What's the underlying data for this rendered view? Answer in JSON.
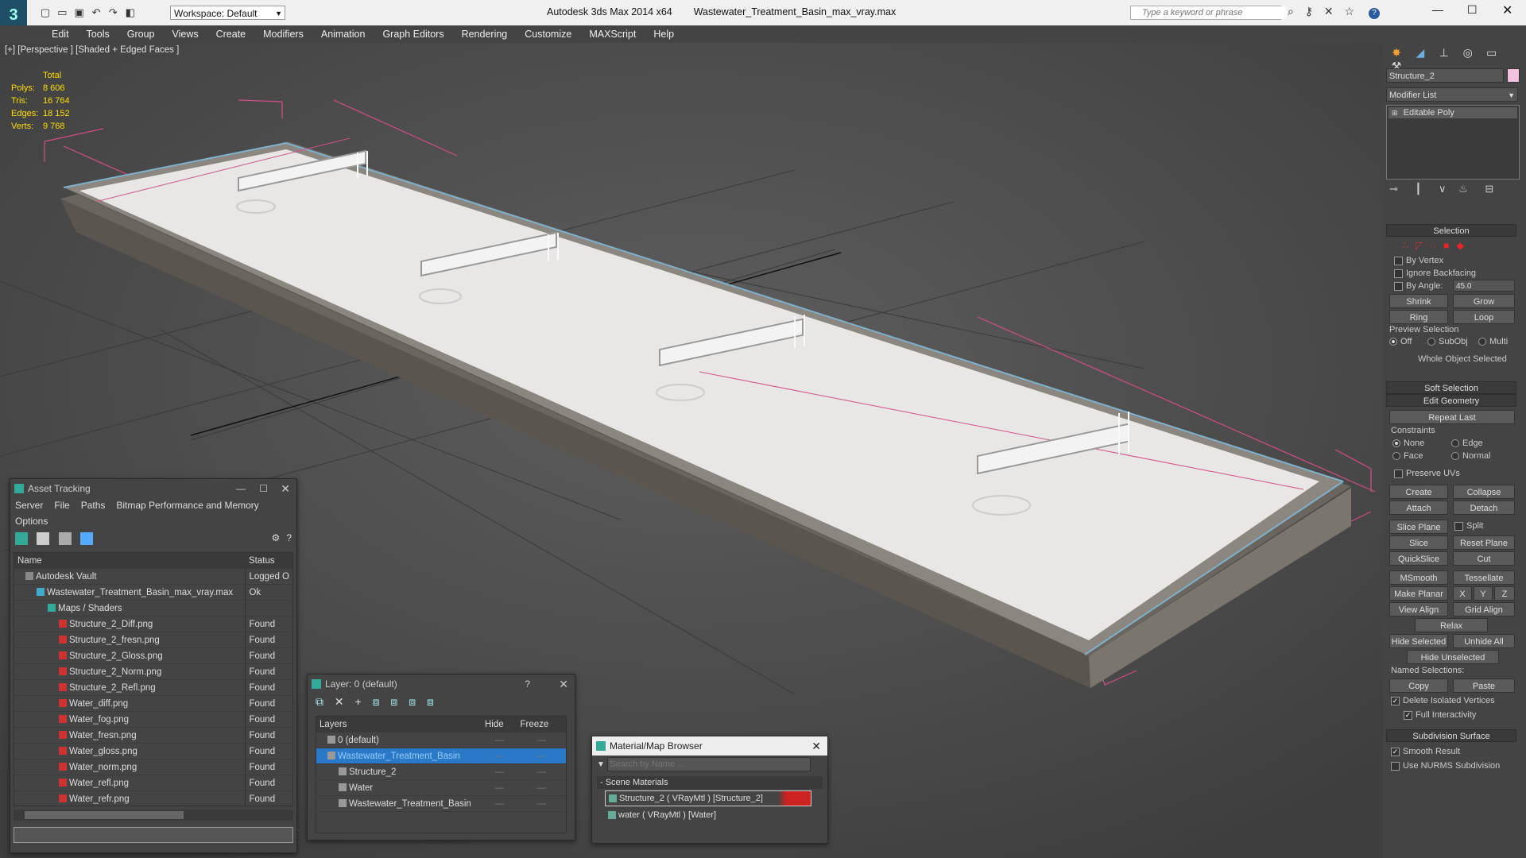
{
  "titlebar": {
    "app_title": "Autodesk 3ds Max  2014 x64",
    "file_title": "Wastewater_Treatment_Basin_max_vray.max",
    "workspace": "Workspace: Default",
    "search_placeholder": "Type a keyword or phrase"
  },
  "menu": [
    "Edit",
    "Tools",
    "Group",
    "Views",
    "Create",
    "Modifiers",
    "Animation",
    "Graph Editors",
    "Rendering",
    "Customize",
    "MAXScript",
    "Help"
  ],
  "viewport": {
    "label": "[+] [Perspective ] [Shaded + Edged Faces ]",
    "stats": {
      "header": "Total",
      "polys_label": "Polys:",
      "polys": "8 606",
      "tris_label": "Tris:",
      "tris": "16 764",
      "edges_label": "Edges:",
      "edges": "18 152",
      "verts_label": "Verts:",
      "verts": "9 768"
    }
  },
  "command_panel": {
    "object_name": "Structure_2",
    "modifier_list": "Modifier List",
    "stack_item": "Editable Poly",
    "selection": {
      "title": "Selection",
      "by_vertex": "By Vertex",
      "ignore_backfacing": "Ignore Backfacing",
      "by_angle": "By Angle:",
      "angle_value": "45.0",
      "shrink": "Shrink",
      "grow": "Grow",
      "ring": "Ring",
      "loop": "Loop",
      "preview_selection": "Preview Selection",
      "off": "Off",
      "subobj": "SubObj",
      "multi": "Multi",
      "status": "Whole Object Selected"
    },
    "soft_selection": "Soft Selection",
    "edit_geometry": {
      "title": "Edit Geometry",
      "repeat_last": "Repeat Last",
      "constraints": "Constraints",
      "none": "None",
      "edge": "Edge",
      "face": "Face",
      "normal": "Normal",
      "preserve_uvs": "Preserve UVs",
      "create": "Create",
      "collapse": "Collapse",
      "attach": "Attach",
      "detach": "Detach",
      "slice_plane": "Slice Plane",
      "split": "Split",
      "slice": "Slice",
      "reset_plane": "Reset Plane",
      "quickslice": "QuickSlice",
      "cut": "Cut",
      "msmooth": "MSmooth",
      "tessellate": "Tessellate",
      "make_planar": "Make Planar",
      "x": "X",
      "y": "Y",
      "z": "Z",
      "view_align": "View Align",
      "grid_align": "Grid Align",
      "relax": "Relax",
      "hide_selected": "Hide Selected",
      "unhide_all": "Unhide All",
      "hide_unselected": "Hide Unselected",
      "named_selections": "Named Selections:",
      "copy": "Copy",
      "paste": "Paste",
      "delete_isolated": "Delete Isolated Vertices",
      "full_interactivity": "Full Interactivity"
    },
    "subdivision_surface": {
      "title": "Subdivision Surface",
      "smooth_result": "Smooth Result",
      "use_nurms": "Use NURMS Subdivision"
    }
  },
  "asset_tracking": {
    "title": "Asset Tracking",
    "menu": [
      "Server",
      "File",
      "Paths",
      "Bitmap Performance and Memory"
    ],
    "menu2": "Options",
    "col_name": "Name",
    "col_status": "Status",
    "rows": [
      {
        "name": "Autodesk Vault",
        "status": "Logged O",
        "indent": 1
      },
      {
        "name": "Wastewater_Treatment_Basin_max_vray.max",
        "status": "Ok",
        "indent": 2
      },
      {
        "name": "Maps / Shaders",
        "status": "",
        "indent": 3
      },
      {
        "name": "Structure_2_Diff.png",
        "status": "Found",
        "indent": 4
      },
      {
        "name": "Structure_2_fresn.png",
        "status": "Found",
        "indent": 4
      },
      {
        "name": "Structure_2_Gloss.png",
        "status": "Found",
        "indent": 4
      },
      {
        "name": "Structure_2_Norm.png",
        "status": "Found",
        "indent": 4
      },
      {
        "name": "Structure_2_Refl.png",
        "status": "Found",
        "indent": 4
      },
      {
        "name": "Water_diff.png",
        "status": "Found",
        "indent": 4
      },
      {
        "name": "Water_fog.png",
        "status": "Found",
        "indent": 4
      },
      {
        "name": "Water_fresn.png",
        "status": "Found",
        "indent": 4
      },
      {
        "name": "Water_gloss.png",
        "status": "Found",
        "indent": 4
      },
      {
        "name": "Water_norm.png",
        "status": "Found",
        "indent": 4
      },
      {
        "name": "Water_refl.png",
        "status": "Found",
        "indent": 4
      },
      {
        "name": "Water_refr.png",
        "status": "Found",
        "indent": 4
      }
    ]
  },
  "layer_window": {
    "title": "Layer: 0 (default)",
    "help": "?",
    "col_layers": "Layers",
    "col_hide": "Hide",
    "col_freeze": "Freeze",
    "rows": [
      {
        "name": "0 (default)",
        "indent": 1,
        "selected": false
      },
      {
        "name": "Wastewater_Treatment_Basin",
        "indent": 1,
        "selected": true
      },
      {
        "name": "Structure_2",
        "indent": 2,
        "selected": false
      },
      {
        "name": "Water",
        "indent": 2,
        "selected": false
      },
      {
        "name": "Wastewater_Treatment_Basin",
        "indent": 2,
        "selected": false
      }
    ]
  },
  "material_browser": {
    "title": "Material/Map Browser",
    "search_placeholder": "Search by Name ...",
    "group": "- Scene Materials",
    "items": [
      "Structure_2  ( VRayMtl )  [Structure_2]",
      "water  ( VRayMtl )  [Water]"
    ]
  }
}
